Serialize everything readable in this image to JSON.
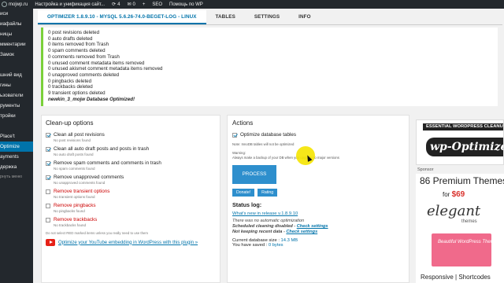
{
  "admin_bar": {
    "site": "mojwp.ru",
    "page_title": "Настройка и унификация сайт...",
    "updates": "4",
    "comments": "0",
    "new": "+",
    "seo": "SEO",
    "help": "Помощь по WP"
  },
  "sidebar": {
    "items": [
      {
        "label": "иси",
        "active": false
      },
      {
        "label": "иафайлы",
        "active": false
      },
      {
        "label": "ницы",
        "active": false
      },
      {
        "label": "мментарии",
        "active": false
      },
      {
        "label": "Замок",
        "active": false
      },
      {
        "label": "",
        "active": false
      },
      {
        "label": "шний вид",
        "active": false
      },
      {
        "label": "гины",
        "active": false
      },
      {
        "label": "ьзователи",
        "active": false
      },
      {
        "label": "рументы",
        "active": false
      },
      {
        "label": "тройки",
        "active": false
      },
      {
        "label": "",
        "active": false
      },
      {
        "label": "Place't",
        "active": false
      },
      {
        "label": "Optimize",
        "active": true
      },
      {
        "label": "ayments",
        "active": false
      },
      {
        "label": "держка",
        "active": false
      },
      {
        "label": "рнуть меню",
        "active": false
      }
    ]
  },
  "tabs": [
    {
      "label": "OPTIMIZER 1.8.9.10 - MYSQL 5.6.26-74.0-BEGET-LOG - LINUX",
      "active": true
    },
    {
      "label": "TABLES",
      "active": false
    },
    {
      "label": "SETTINGS",
      "active": false
    },
    {
      "label": "INFO",
      "active": false
    }
  ],
  "log": [
    "0 post revisions deleted",
    "0 auto drafts deleted",
    "0 items removed from Trash",
    "0 spam comments deleted",
    "0 comments removed from Trash",
    "0 unused comment metadata items removed",
    "0 unused akismet comment metadata items removed",
    "0 unapproved comments deleted",
    "0 pingbacks deleted",
    "0 trackbacks deleted",
    "9 transient options deleted",
    "newkin_3_mojw Database Optimized!"
  ],
  "cleanup": {
    "title": "Clean-up options",
    "options": [
      {
        "label": "Clean all post revisions",
        "sub": "No post revisions found",
        "checked": true,
        "danger": false
      },
      {
        "label": "Clean all auto draft posts and posts in trash",
        "sub": "No auto draft posts found",
        "checked": true,
        "danger": false
      },
      {
        "label": "Remove spam comments and comments in trash",
        "sub": "No spam comments found",
        "checked": true,
        "danger": false
      },
      {
        "label": "Remove unapproved comments",
        "sub": "No unapproved comments found",
        "checked": true,
        "danger": false
      },
      {
        "label": "Remove transient options",
        "sub": "No transient options found",
        "checked": false,
        "danger": true
      },
      {
        "label": "Remove pingbacks",
        "sub": "No pingbacks found",
        "checked": false,
        "danger": true
      },
      {
        "label": "Remove trackbacks",
        "sub": "No trackbacks found",
        "checked": false,
        "danger": true
      }
    ],
    "note": "Do not select RED marked items unless you really need to use them",
    "youtube_link": "Optimize your YouTube embedding in WordPress with this plugin »"
  },
  "actions": {
    "title": "Actions",
    "optimize_label": "Optimize database tables",
    "optimize_checked": true,
    "innodb_note": "Note:   InnoDB tables will not be optimized",
    "warning_title": "Warning:",
    "warning_text": "Always make a backup of your DB when you upgrade to major versions",
    "process_button": "PROCESS",
    "donate_button": "Donate!",
    "rating_button": "Rating",
    "status_title": "Status log:",
    "whats_new": "What's new in release v.1.8.9.10",
    "status_1": "There was no automatic optimization",
    "status_2": "Scheduled cleaning disabled - ",
    "status_3": "Not keeping recent data - ",
    "check_settings": "Check settings",
    "db_size_label": "Current database size : ",
    "db_size_value": "14.3 MB",
    "saved_label": "You have saved : ",
    "saved_value": "0 bytes"
  },
  "ads": {
    "wpo_tagline": "ESSENTIAL WORDPRESS CLEANUP",
    "wpo_logo": "wp-Optimize",
    "sponsor_label": "Sponsor",
    "et_title": "86 Premium Themes",
    "et_price_prefix": "for ",
    "et_price": "$69",
    "et_brand": "elegant",
    "et_brand_sub": "themes",
    "et_mock_text": "Beautiful WordPress Themes",
    "et_footer": "Responsive | Shortcodes"
  },
  "colors": {
    "admin_bg": "#23282d",
    "accent": "#0073aa",
    "button": "#2e8fcd",
    "danger": "#cc0000",
    "notice_border": "#7ad03a",
    "cursor_highlight": "#f5e400"
  }
}
